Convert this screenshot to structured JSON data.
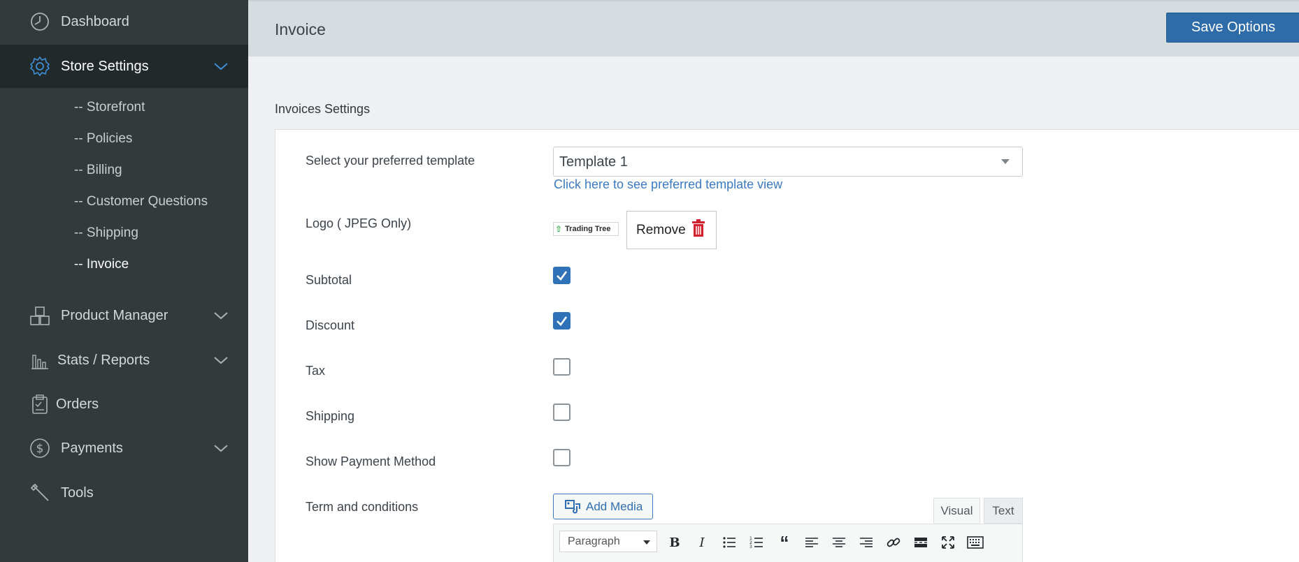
{
  "sidebar": {
    "dashboard": "Dashboard",
    "store_settings": "Store Settings",
    "sub_items": [
      "-- Storefront",
      "-- Policies",
      "-- Billing",
      "-- Customer Questions",
      "-- Shipping",
      "-- Invoice"
    ],
    "product_manager": "Product Manager",
    "stats_reports": "Stats / Reports",
    "orders": "Orders",
    "payments": "Payments",
    "tools": "Tools"
  },
  "header": {
    "title": "Invoice",
    "save_label": "Save Options"
  },
  "main": {
    "section_title": "Invoices Settings",
    "template_label": "Select your preferred template",
    "template_value": "Template 1",
    "template_link": "Click here to see preferred template view",
    "logo_label": "Logo ( JPEG Only)",
    "logo_text": "Trading Tree",
    "remove_label": "Remove",
    "subtotal_label": "Subtotal",
    "discount_label": "Discount",
    "tax_label": "Tax",
    "shipping_label": "Shipping",
    "payment_method_label": "Show Payment Method",
    "terms_label": "Term and conditions",
    "add_media_label": "Add Media",
    "tab_visual": "Visual",
    "tab_text": "Text",
    "paragraph_label": "Paragraph"
  },
  "checkboxes": {
    "subtotal": true,
    "discount": true,
    "tax": false,
    "shipping": false,
    "payment_method": false
  },
  "colors": {
    "sidebar_bg": "#323a3c",
    "sidebar_active": "#22292b",
    "accent": "#2d6ca8",
    "link": "#3b7ac1",
    "trash": "#d1202e"
  }
}
